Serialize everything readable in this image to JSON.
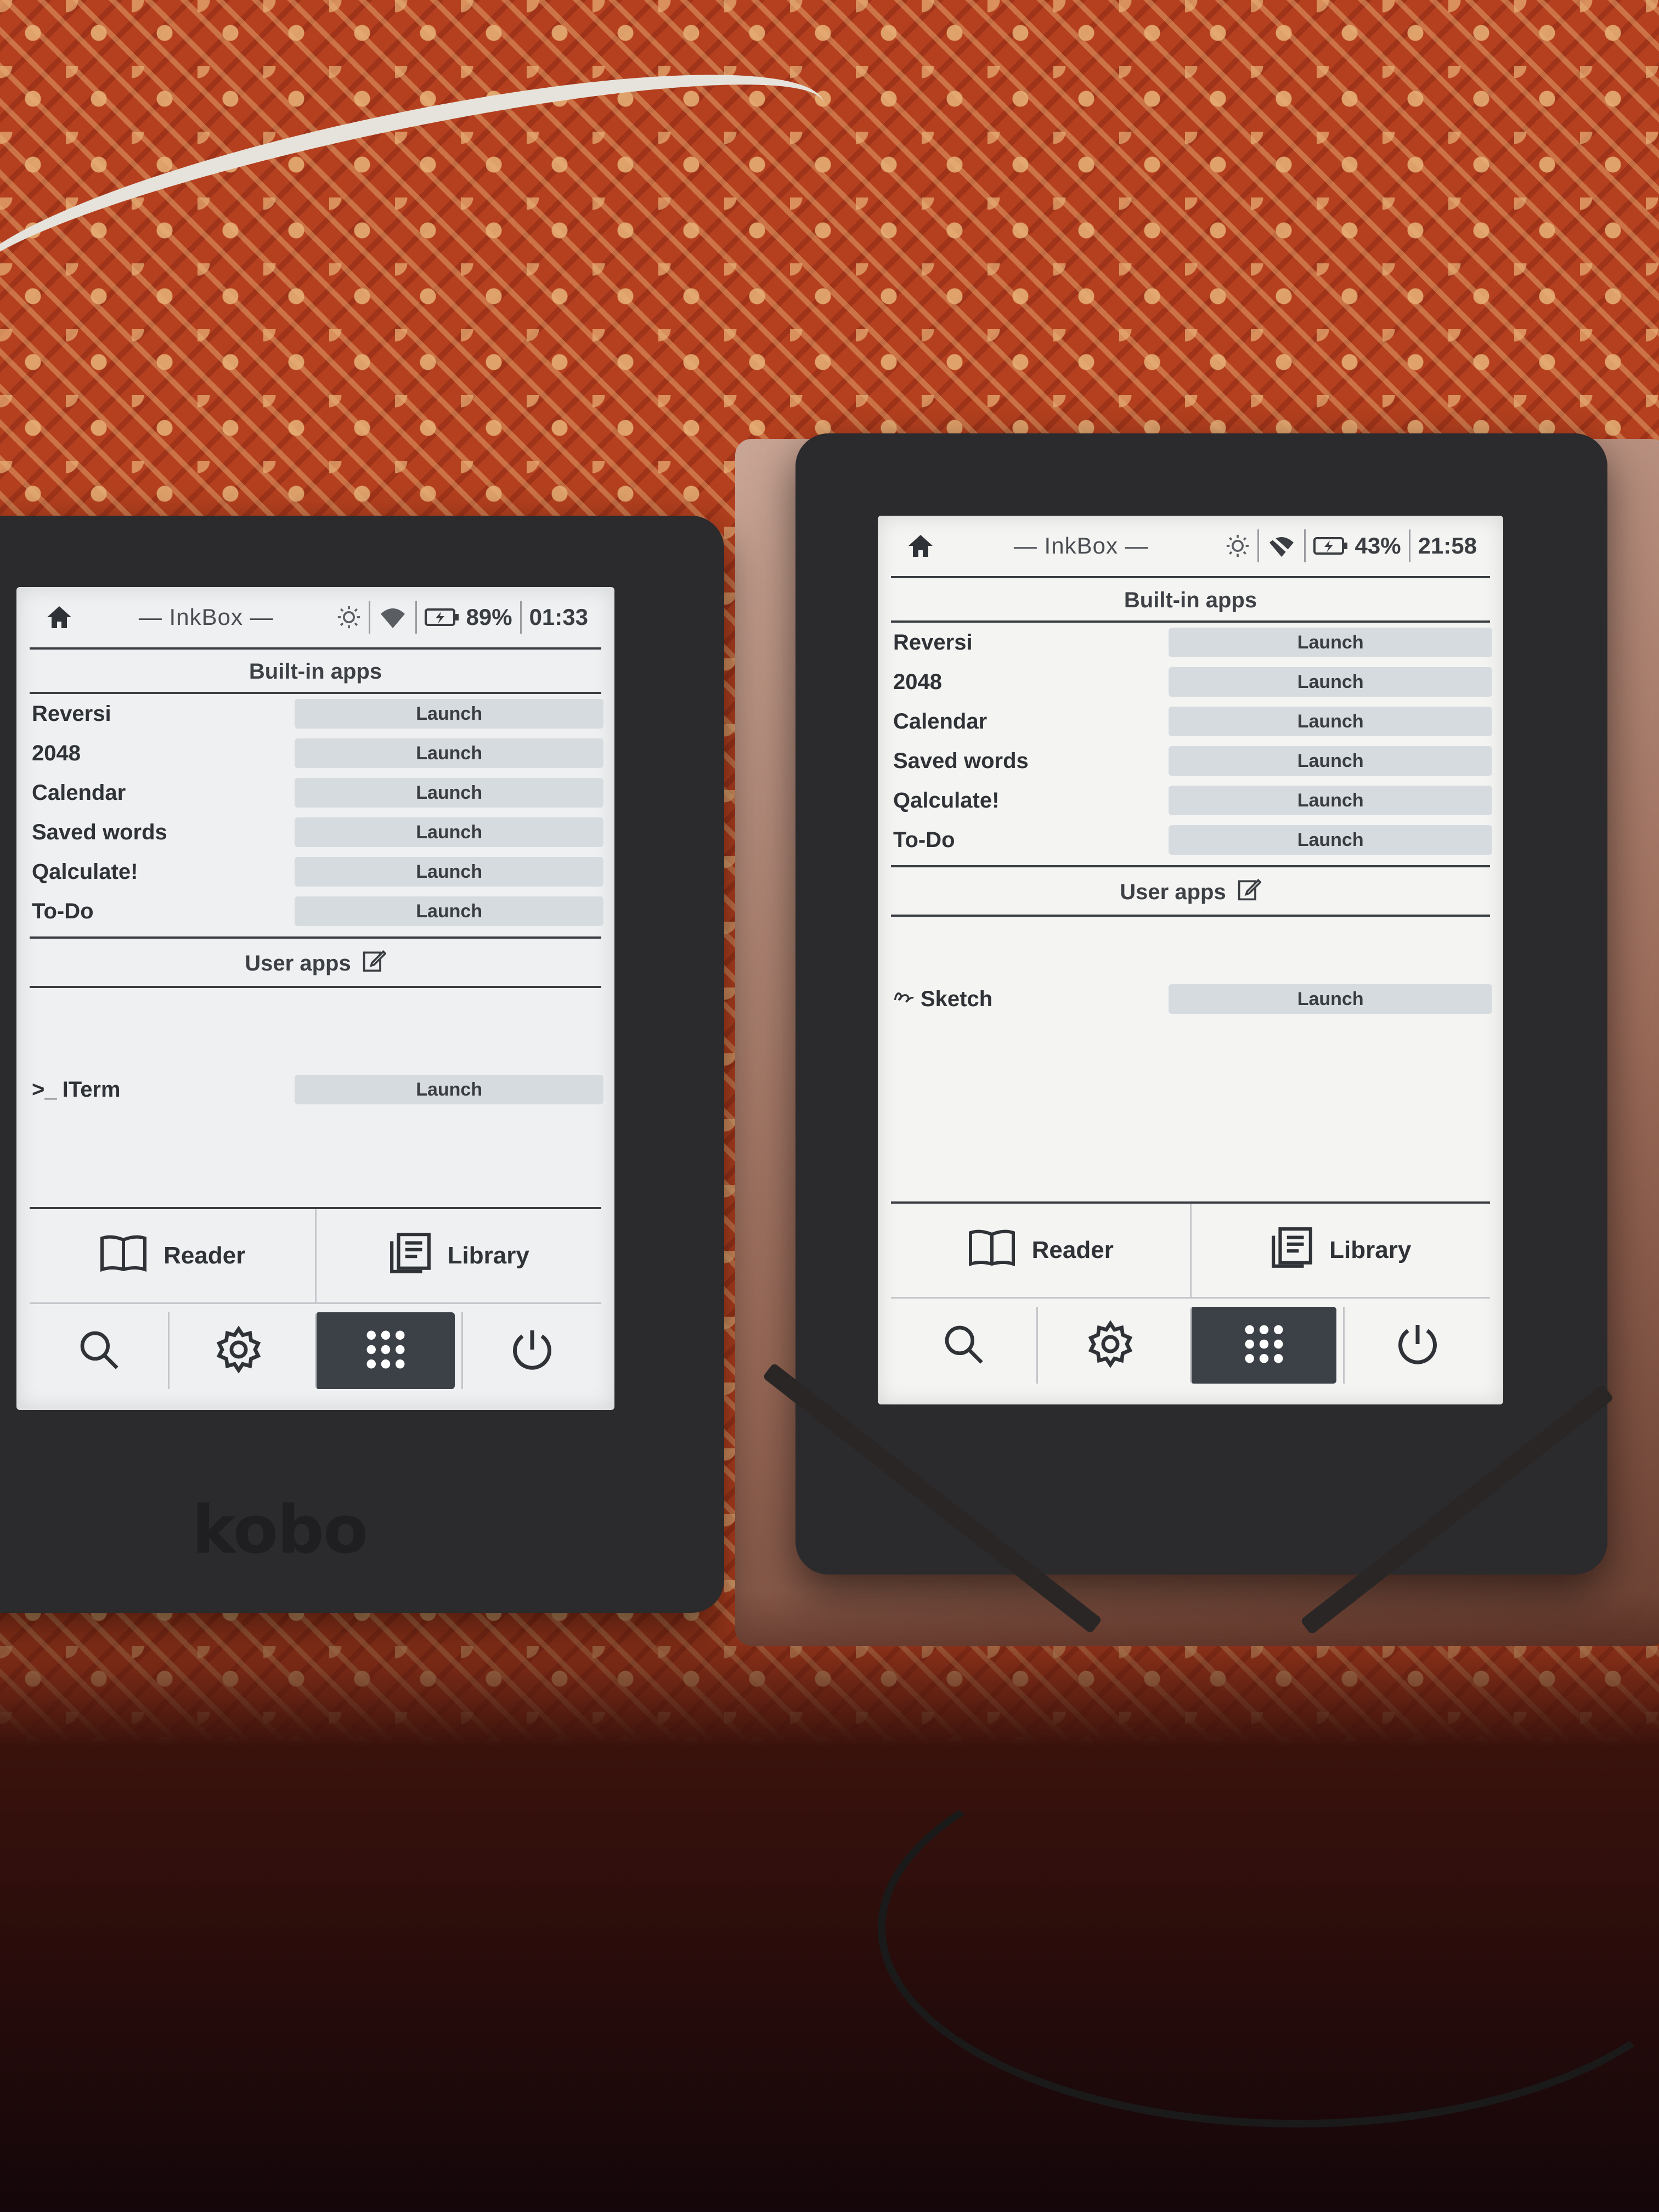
{
  "devices": [
    {
      "brand": "kobo",
      "topbar": {
        "title": "— InkBox —",
        "battery": "89%",
        "time": "01:33"
      },
      "builtin_title": "Built-in apps",
      "builtin_apps": [
        {
          "name": "Reversi",
          "action": "Launch"
        },
        {
          "name": "2048",
          "action": "Launch"
        },
        {
          "name": "Calendar",
          "action": "Launch"
        },
        {
          "name": "Saved words",
          "action": "Launch"
        },
        {
          "name": "Qalculate!",
          "action": "Launch"
        },
        {
          "name": "To-Do",
          "action": "Launch"
        }
      ],
      "user_title": "User apps",
      "user_apps": [
        {
          "name": "ITerm",
          "prefix": ">_",
          "action": "Launch"
        }
      ],
      "shortcuts": {
        "reader": "Reader",
        "library": "Library"
      }
    },
    {
      "topbar": {
        "title": "— InkBox —",
        "battery": "43%",
        "time": "21:58"
      },
      "builtin_title": "Built-in apps",
      "builtin_apps": [
        {
          "name": "Reversi",
          "action": "Launch"
        },
        {
          "name": "2048",
          "action": "Launch"
        },
        {
          "name": "Calendar",
          "action": "Launch"
        },
        {
          "name": "Saved words",
          "action": "Launch"
        },
        {
          "name": "Qalculate!",
          "action": "Launch"
        },
        {
          "name": "To-Do",
          "action": "Launch"
        }
      ],
      "user_title": "User apps",
      "user_apps": [
        {
          "name": "Sketch",
          "prefix": "",
          "action": "Launch"
        }
      ],
      "shortcuts": {
        "reader": "Reader",
        "library": "Library"
      }
    }
  ],
  "icons": [
    "home-icon",
    "brightness-icon",
    "wifi-icon",
    "battery-icon",
    "edit-icon",
    "terminal-icon",
    "sketch-icon",
    "book-icon",
    "library-icon",
    "search-icon",
    "settings-icon",
    "apps-grid-icon",
    "power-icon"
  ]
}
